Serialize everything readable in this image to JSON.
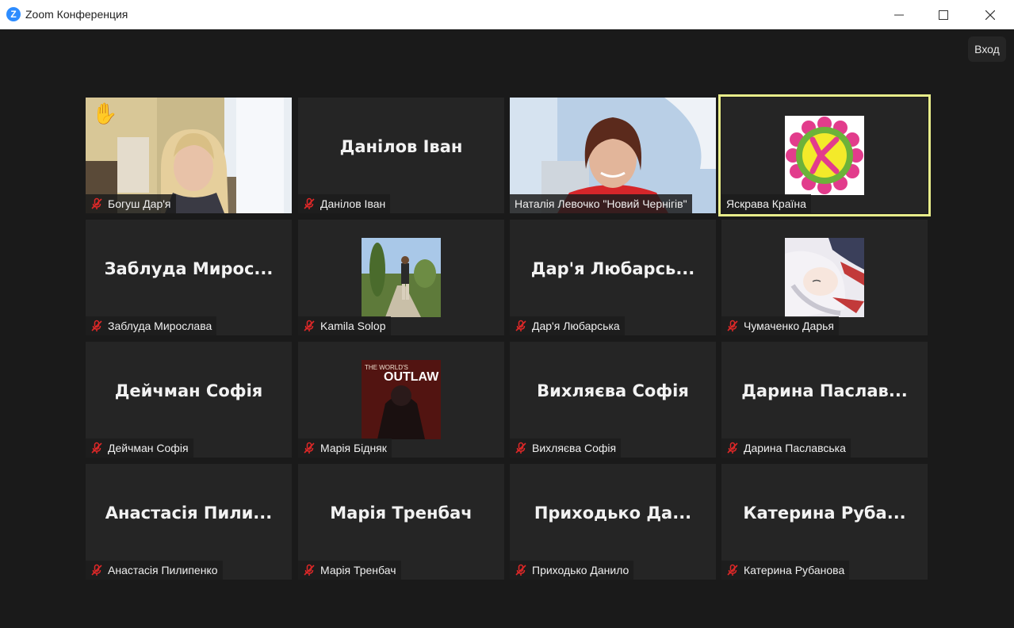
{
  "window": {
    "title": "Zoom Конференция",
    "logo_letter": "Z"
  },
  "controls": {
    "exit_label": "Вход"
  },
  "colors": {
    "active_speaker_border": "#e8ec8a",
    "mic_muted": "#e02828",
    "zoom_blue": "#2d8cff"
  },
  "participants": [
    {
      "label": "Богуш Дар'я",
      "big": "",
      "hand_raised": true,
      "video": "video-girl"
    },
    {
      "label": "Данілов Іван",
      "big": "Данілов Іван",
      "video": ""
    },
    {
      "label": "Наталія Левочко \"Новий Чернігів\"",
      "big": "",
      "video": "video-woman"
    },
    {
      "label": "Яскрава Країна",
      "big": "",
      "video": "avatar-logo",
      "active": true
    },
    {
      "label": "Заблуда Мирослава",
      "big": "Заблуда  Мирос...",
      "video": ""
    },
    {
      "label": "Kamila Solop",
      "big": "",
      "video": "avatar-outdoor"
    },
    {
      "label": "Дар'я Любарська",
      "big": "Дар'я  Любарсь...",
      "video": ""
    },
    {
      "label": "Чумаченко Дарья",
      "big": "",
      "video": "avatar-anime"
    },
    {
      "label": "Дейчман Софія",
      "big": "Дейчман Софія",
      "video": ""
    },
    {
      "label": "Марія Бідняк",
      "big": "",
      "video": "avatar-poster"
    },
    {
      "label": "Вихляєва Софія",
      "big": "Вихляєва Софія",
      "video": ""
    },
    {
      "label": "Дарина Паславська",
      "big": "Дарина  Паслав...",
      "video": ""
    },
    {
      "label": "Анастасія Пилипенко",
      "big": "Анастасія  Пили...",
      "video": ""
    },
    {
      "label": "Марія Тренбач",
      "big": "Марія Тренбач",
      "video": ""
    },
    {
      "label": "Приходько Данило",
      "big": "Приходько  Да...",
      "video": ""
    },
    {
      "label": "Катерина Рубанова",
      "big": "Катерина  Руба...",
      "video": ""
    }
  ],
  "poster_text": {
    "top": "THE WORLD'S",
    "main": "OUTLAW"
  }
}
